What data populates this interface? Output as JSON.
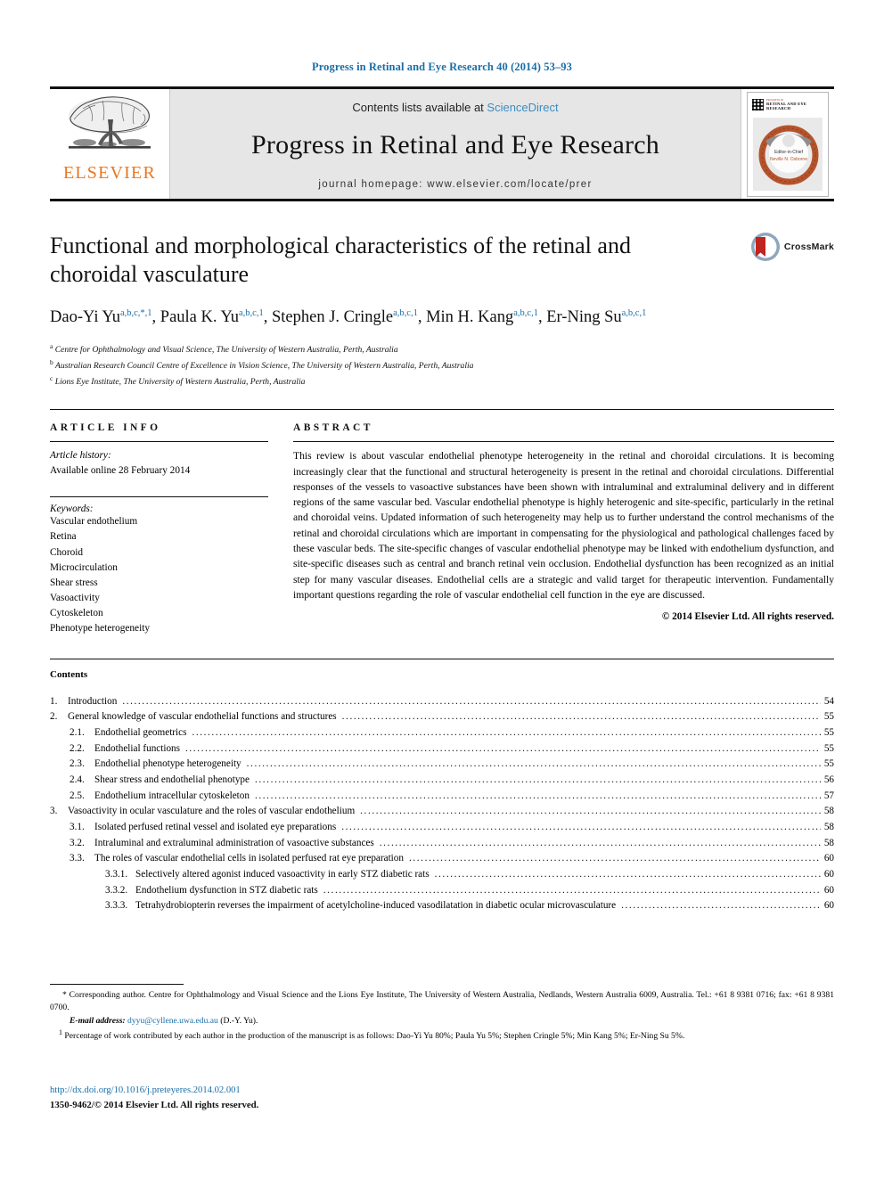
{
  "running_head": "Progress in Retinal and Eye Research 40 (2014) 53–93",
  "banner": {
    "contents_prefix": "Contents lists available at ",
    "sciencedirect": "ScienceDirect",
    "journal_title": "Progress in Retinal and Eye Research",
    "homepage": "journal homepage: www.elsevier.com/locate/prer",
    "publisher_logo_text": "ELSEVIER",
    "cover": {
      "title": "RETINAL AND EYE RESEARCH",
      "kicker": "PROGRESS IN",
      "editor_label": "Editor-in-Chief",
      "editor_name": "Neville N. Osborne"
    }
  },
  "article": {
    "title": "Functional and morphological characteristics of the retinal and choroidal vasculature",
    "authors": [
      {
        "name": "Dao-Yi Yu",
        "marks": "a,b,c,*,1",
        "sep": ", "
      },
      {
        "name": "Paula K. Yu",
        "marks": "a,b,c,1",
        "sep": ", "
      },
      {
        "name": "Stephen J. Cringle",
        "marks": "a,b,c,1",
        "sep": ", "
      },
      {
        "name": "Min H. Kang",
        "marks": "a,b,c,1",
        "sep": ", "
      },
      {
        "name": "Er-Ning Su",
        "marks": "a,b,c,1",
        "sep": ""
      }
    ],
    "affiliations": [
      {
        "mark": "a",
        "text": "Centre for Ophthalmology and Visual Science, The University of Western Australia, Perth, Australia"
      },
      {
        "mark": "b",
        "text": "Australian Research Council Centre of Excellence in Vision Science, The University of Western Australia, Perth, Australia"
      },
      {
        "mark": "c",
        "text": "Lions Eye Institute, The University of Western Australia, Perth, Australia"
      }
    ],
    "crossmark_label": "CrossMark"
  },
  "article_info": {
    "heading": "ARTICLE INFO",
    "history_label": "Article history:",
    "history_value": "Available online 28 February 2014",
    "keywords_label": "Keywords:",
    "keywords": [
      "Vascular endothelium",
      "Retina",
      "Choroid",
      "Microcirculation",
      "Shear stress",
      "Vasoactivity",
      "Cytoskeleton",
      "Phenotype heterogeneity"
    ]
  },
  "abstract": {
    "heading": "ABSTRACT",
    "text": "This review is about vascular endothelial phenotype heterogeneity in the retinal and choroidal circulations. It is becoming increasingly clear that the functional and structural heterogeneity is present in the retinal and choroidal circulations. Differential responses of the vessels to vasoactive substances have been shown with intraluminal and extraluminal delivery and in different regions of the same vascular bed. Vascular endothelial phenotype is highly heterogenic and site-specific, particularly in the retinal and choroidal veins. Updated information of such heterogeneity may help us to further understand the control mechanisms of the retinal and choroidal circulations which are important in compensating for the physiological and pathological challenges faced by these vascular beds. The site-specific changes of vascular endothelial phenotype may be linked with endothelium dysfunction, and site-specific diseases such as central and branch retinal vein occlusion. Endothelial dysfunction has been recognized as an initial step for many vascular diseases. Endothelial cells are a strategic and valid target for therapeutic intervention. Fundamentally important questions regarding the role of vascular endothelial cell function in the eye are discussed.",
    "copyright": "© 2014 Elsevier Ltd. All rights reserved."
  },
  "contents": {
    "heading": "Contents",
    "entries": [
      {
        "level": 1,
        "num": "1.",
        "label": "Introduction",
        "page": "54"
      },
      {
        "level": 1,
        "num": "2.",
        "label": "General knowledge of vascular endothelial functions and structures",
        "page": "55"
      },
      {
        "level": 2,
        "num": "2.1.",
        "label": "Endothelial geometrics",
        "page": "55"
      },
      {
        "level": 2,
        "num": "2.2.",
        "label": "Endothelial functions",
        "page": "55"
      },
      {
        "level": 2,
        "num": "2.3.",
        "label": "Endothelial phenotype heterogeneity",
        "page": "55"
      },
      {
        "level": 2,
        "num": "2.4.",
        "label": "Shear stress and endothelial phenotype",
        "page": "56"
      },
      {
        "level": 2,
        "num": "2.5.",
        "label": "Endothelium intracellular cytoskeleton",
        "page": "57"
      },
      {
        "level": 1,
        "num": "3.",
        "label": "Vasoactivity in ocular vasculature and the roles of vascular endothelium",
        "page": "58"
      },
      {
        "level": 2,
        "num": "3.1.",
        "label": "Isolated perfused retinal vessel and isolated eye preparations",
        "page": "58"
      },
      {
        "level": 2,
        "num": "3.2.",
        "label": "Intraluminal and extraluminal administration of vasoactive substances",
        "page": "58"
      },
      {
        "level": 2,
        "num": "3.3.",
        "label": "The roles of vascular endothelial cells in isolated perfused rat eye preparation",
        "page": "60"
      },
      {
        "level": 3,
        "num": "3.3.1.",
        "label": "Selectively altered agonist induced vasoactivity in early STZ diabetic rats",
        "page": "60"
      },
      {
        "level": 3,
        "num": "3.3.2.",
        "label": "Endothelium dysfunction in STZ diabetic rats",
        "page": "60"
      },
      {
        "level": 3,
        "num": "3.3.3.",
        "label": "Tetrahydrobiopterin reverses the impairment of acetylcholine-induced vasodilatation in diabetic ocular microvasculature",
        "page": "60"
      }
    ]
  },
  "footnotes": {
    "corresponding_mark": "*",
    "corresponding": "Corresponding author. Centre for Ophthalmology and Visual Science and the Lions Eye Institute, The University of Western Australia, Nedlands, Western Australia 6009, Australia. Tel.: +61 8 9381 0716; fax: +61 8 9381 0700.",
    "email_label": "E-mail address:",
    "email": "dyyu@cyllene.uwa.edu.au",
    "email_person": "(D.-Y. Yu).",
    "contrib_mark": "1",
    "contribution": "Percentage of work contributed by each author in the production of the manuscript is as follows: Dao-Yi Yu 80%; Paula Yu 5%; Stephen Cringle 5%; Min Kang 5%; Er-Ning Su 5%."
  },
  "doi": "http://dx.doi.org/10.1016/j.preteyeres.2014.02.001",
  "issn_copyright": "1350-9462/© 2014 Elsevier Ltd. All rights reserved.",
  "colors": {
    "link_blue": "#1a6ea8",
    "sciencedirect_blue": "#3c8dc5",
    "elsevier_orange": "#E87722",
    "banner_gray": "#e6e6e6",
    "crossmark_red": "#c0241f",
    "crossmark_blue": "#5b7fa6"
  }
}
